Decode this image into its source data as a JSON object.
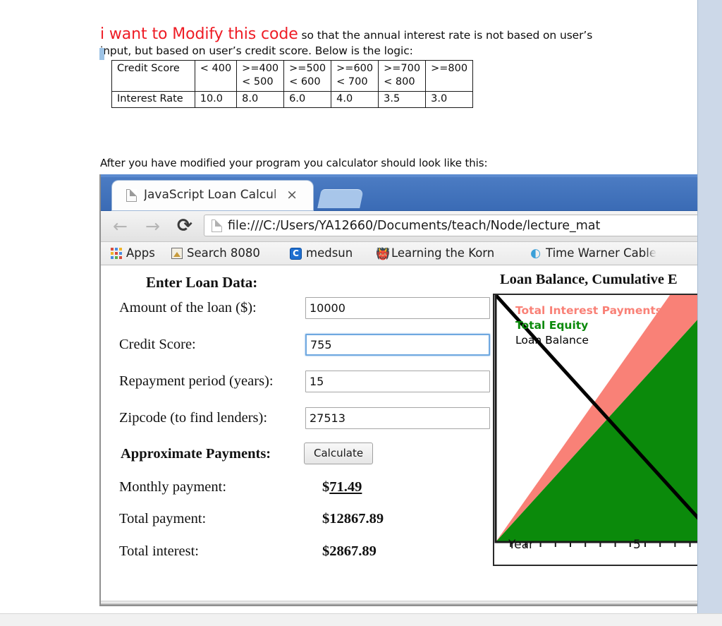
{
  "document": {
    "intro_highlight": "i want to Modify this code",
    "intro_rest": " so that the annual interest rate is not based on user’s input, but based on user’s credit score. Below is the logic:",
    "after_text": "After you have modified your program you calculator should look like this:"
  },
  "rate_table": {
    "rows": [
      {
        "label": "Credit Score",
        "cells": [
          "< 400",
          ">=400\n< 500",
          ">=500\n< 600",
          ">=600\n< 700",
          ">=700\n< 800",
          ">=800"
        ]
      },
      {
        "label": "Interest Rate",
        "cells": [
          "10.0",
          "8.0",
          "6.0",
          "4.0",
          "3.5",
          "3.0"
        ]
      }
    ]
  },
  "browser": {
    "tab": {
      "title": "JavaScript Loan Calcul",
      "close_label": "×"
    },
    "toolbar": {
      "back_icon": "←",
      "forward_icon": "→",
      "reload_icon": "⟳",
      "url": "file:///C:/Users/YA12660/Documents/teach/Node/lecture_mat"
    },
    "bookmarks": [
      {
        "label": "Apps",
        "icon": "apps-grid-icon"
      },
      {
        "label": "Search 8080",
        "icon": "image-icon"
      },
      {
        "label": "medsun",
        "icon": "letter-c-icon",
        "icon_text": "C"
      },
      {
        "label": "Learning the Korn",
        "icon": "devil-icon",
        "icon_text": "👹"
      },
      {
        "label": "Time Warner Cable",
        "icon": "swirl-icon",
        "icon_text": "◐"
      }
    ]
  },
  "calculator": {
    "form_heading": "Enter Loan Data:",
    "fields": [
      {
        "label": "Amount of the loan ($):",
        "value": "10000",
        "focused": false
      },
      {
        "label": "Credit Score:",
        "value": "755",
        "focused": true
      },
      {
        "label": "Repayment period (years):",
        "value": "15",
        "focused": false
      },
      {
        "label": "Zipcode (to find lenders):",
        "value": "27513",
        "focused": false
      }
    ],
    "payments_heading": "Approximate Payments:",
    "calculate_label": "Calculate",
    "results": [
      {
        "label": "Monthly payment:",
        "value_prefix": "$",
        "value": "71.49",
        "underlined": true
      },
      {
        "label": "Total payment:",
        "value_prefix": "$",
        "value": "12867.89",
        "underlined": false
      },
      {
        "label": "Total interest:",
        "value_prefix": "$",
        "value": "2867.89",
        "underlined": false
      }
    ]
  },
  "chart_data": {
    "type": "area",
    "title": "Loan Balance, Cumulative E",
    "xlabel": "Year",
    "ylabel": "",
    "xlim": [
      0,
      15
    ],
    "ylim": [
      0,
      10000
    ],
    "grid": false,
    "legend_position": "top-left",
    "x_ticks_labeled": [
      {
        "value": 5,
        "label": "5"
      }
    ],
    "series": [
      {
        "name": "Total Interest Payments",
        "color": "#F98177",
        "type": "area",
        "x": [
          0,
          15
        ],
        "values": [
          0,
          2867.89
        ]
      },
      {
        "name": "Total Equity",
        "color": "#0B8A0B",
        "type": "area",
        "x": [
          0,
          15
        ],
        "values": [
          0,
          10000
        ]
      },
      {
        "name": "Loan Balance",
        "color": "#000000",
        "type": "line",
        "x": [
          0,
          15
        ],
        "values": [
          10000,
          0
        ]
      }
    ]
  },
  "colors": {
    "highlight_red": "#ee1c25",
    "interest_salmon": "#F98177",
    "equity_green": "#0B8A0B",
    "balance_black": "#000000",
    "chrome_blue": "#3a6bb5",
    "focus_blue": "#6fa8e0"
  }
}
